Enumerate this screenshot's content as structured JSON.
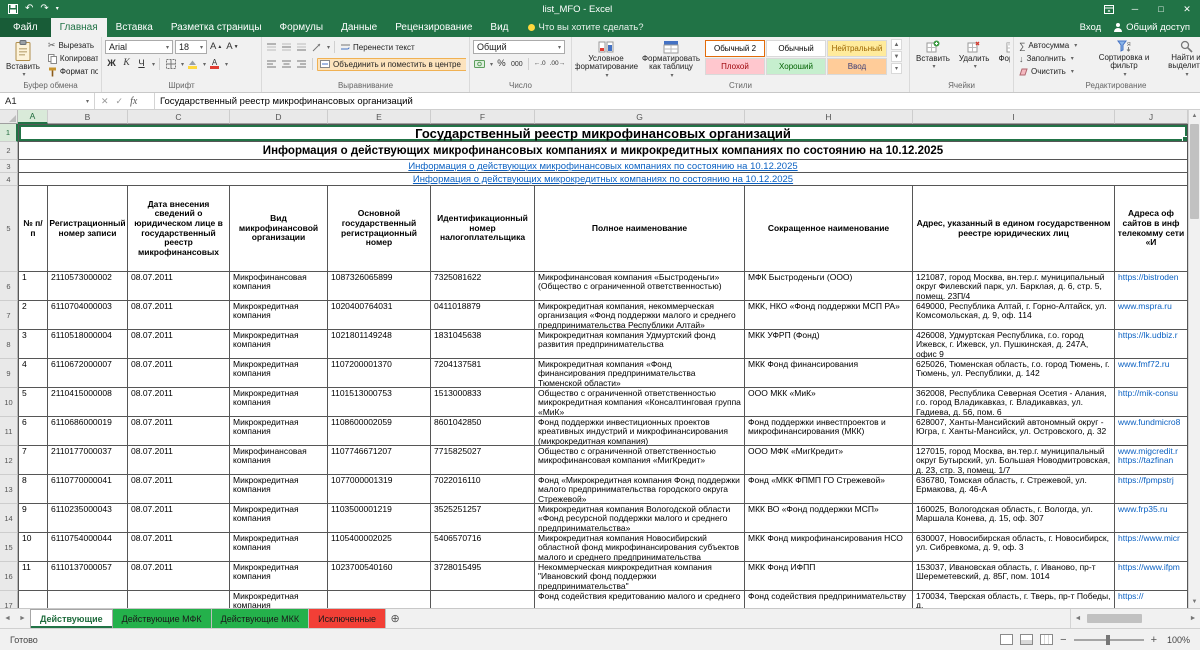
{
  "window": {
    "title": "list_MFO - Excel",
    "sign_in": "Вход",
    "share": "Общий доступ"
  },
  "ribbon": {
    "file_tab": "Файл",
    "tabs": [
      "Главная",
      "Вставка",
      "Разметка страницы",
      "Формулы",
      "Данные",
      "Рецензирование",
      "Вид"
    ],
    "active_tab": "Главная",
    "tell_me": "Что вы хотите сделать?",
    "groups": {
      "clipboard": {
        "label": "Буфер обмена",
        "paste": "Вставить",
        "cut": "Вырезать",
        "copy": "Копировать",
        "painter": "Формат по образцу"
      },
      "font": {
        "label": "Шрифт",
        "family": "Arial",
        "size": "18",
        "bold": "Ж",
        "italic": "К",
        "underline": "Ч"
      },
      "alignment": {
        "label": "Выравнивание",
        "wrap": "Перенести текст",
        "merge": "Объединить и поместить в центре"
      },
      "number": {
        "label": "Число",
        "format": "Общий",
        "percent": "%",
        "thousands": "000"
      },
      "styles": {
        "label": "Стили",
        "conditional": "Условное форматирование",
        "as_table": "Форматировать как таблицу",
        "gallery": [
          {
            "name": "Обычный 2",
            "bg": "#ffffff",
            "fg": "#000000"
          },
          {
            "name": "Обычный",
            "bg": "#ffffff",
            "fg": "#000000"
          },
          {
            "name": "Нейтральный",
            "bg": "#ffeb9c",
            "fg": "#9c6500"
          },
          {
            "name": "Плохой",
            "bg": "#ffc7ce",
            "fg": "#9c0006"
          },
          {
            "name": "Хороший",
            "bg": "#c6efce",
            "fg": "#006100"
          },
          {
            "name": "Ввод",
            "bg": "#ffcc99",
            "fg": "#3f3f76"
          }
        ]
      },
      "cells": {
        "label": "Ячейки",
        "insert": "Вставить",
        "delete": "Удалить",
        "format": "Формат"
      },
      "editing": {
        "label": "Редактирование",
        "autosum": "Автосумма",
        "fill": "Заполнить",
        "clear": "Очистить",
        "sort": "Сортировка и фильтр",
        "find": "Найти и выделить"
      }
    }
  },
  "formula_bar": {
    "name_box": "A1",
    "fx": "fx",
    "value": "Государственный реестр микрофинансовых организаций"
  },
  "sheet": {
    "col_letters": [
      "A",
      "B",
      "C",
      "D",
      "E",
      "F",
      "G",
      "H",
      "I",
      "J"
    ],
    "top_rows": [
      {
        "row": 1,
        "style": "m-title",
        "text": "Государственный реестр микрофинансовых организаций"
      },
      {
        "row": 2,
        "style": "m-subtitle",
        "text": "Информация о действующих микрофинансовых компаниях и микрокредитных компаниях по состоянию на 10.12.2025"
      },
      {
        "row": 3,
        "style": "m-link",
        "text": "Информация о действующих микрофинансовых компаниях по состоянию на 10.12.2025"
      },
      {
        "row": 4,
        "style": "m-link",
        "text": "Информация о действующих микрокредитных компаниях по состоянию на 10.12.2025"
      }
    ],
    "header_row_num": 5,
    "headers": [
      "№ п/п",
      "Регистрационный номер записи",
      "Дата внесения сведений о юридическом лице в государственный реестр микрофинансовых",
      "Вид микрофинансовой организации",
      "Основной государственный регистрационный номер",
      "Идентификационный номер налогоплательщика",
      "Полное наименование",
      "Сокращенное наименование",
      "Адрес, указанный в едином государственном реестре юридических лиц",
      "Адреса оф сайтов в инф телекомму сети «И"
    ],
    "rows": [
      [
        "1",
        "2110573000002",
        "08.07.2011",
        "Микрофинансовая компания",
        "1087326065899",
        "7325081622",
        "Микрофинансовая компания «Быстроденьги» (Общество с ограниченной ответственностью)",
        "МФК Быстроденьги (ООО)",
        "121087, город Москва, вн.тер.г. муниципальный округ Филевский парк, ул. Барклая, д. 6, стр. 5, помещ. 23П/4",
        "https://bistroden"
      ],
      [
        "2",
        "6110704000003",
        "08.07.2011",
        "Микрокредитная компания",
        "1020400764031",
        "0411018879",
        "Микрокредитная компания, некоммерческая организация «Фонд поддержки малого и среднего предпринимательства Республики Алтай»",
        "МКК, НКО «Фонд поддержки МСП РА»",
        "649000, Республика Алтай, г. Горно-Алтайск, ул. Комсомольская, д. 9, оф. 114",
        "www.mspra.ru"
      ],
      [
        "3",
        "6110518000004",
        "08.07.2011",
        "Микрокредитная компания",
        "1021801149248",
        "1831045638",
        "Микрокредитная компания Удмуртский фонд развития предпринимательства",
        "МКК УФРП (Фонд)",
        "426008, Удмуртская Республика, г.о. город Ижевск, г. Ижевск, ул. Пушкинская, д. 247А, офис 9",
        "https://lk.udbiz.r"
      ],
      [
        "4",
        "6110672000007",
        "08.07.2011",
        "Микрокредитная компания",
        "1107200001370",
        "7204137581",
        "Микрокредитная компания «Фонд финансирования предпринимательства Тюменской области»",
        "МКК Фонд финансирования",
        "625026, Тюменская область, г.о. город Тюмень, г. Тюмень, ул. Республики, д. 142",
        "www.fmf72.ru"
      ],
      [
        "5",
        "2110415000008",
        "08.07.2011",
        "Микрокредитная компания",
        "1101513000753",
        "1513000833",
        "Общество с ограниченной ответственностью микрокредитная компания «Консалтинговая группа «МиК»",
        "ООО МКК «МиК»",
        "362008, Республика Северная Осетия - Алания, г.о. город Владикавказ, г. Владикавказ, ул. Гадиева, д. 56, пом. 6",
        "http://mik-consu"
      ],
      [
        "6",
        "6110686000019",
        "08.07.2011",
        "Микрокредитная компания",
        "1108600002059",
        "8601042850",
        "Фонд поддержки инвестиционных проектов креативных индустрий и микрофинансирования (микрокредитная компания)",
        "Фонд поддержки инвестпроектов и микрофинансирования (МКК)",
        "628007, Ханты-Мансийский автономный округ - Югра, г. Ханты-Мансийск, ул. Островского, д. 32",
        "www.fundmicro8"
      ],
      [
        "7",
        "2110177000037",
        "08.07.2011",
        "Микрофинансовая компания",
        "1107746671207",
        "7715825027",
        "Общество с ограниченной ответственностью микрофинансовая компания «МигКредит»",
        "ООО МФК «МигКредит»",
        "127015, город Москва, вн.тер.г. муниципальный округ Бутырский, ул. Большая Новодмитровская, д. 23, стр. 3, помещ. 1/7",
        "www.migcredit.r https://tazfinan"
      ],
      [
        "8",
        "6110770000041",
        "08.07.2011",
        "Микрокредитная компания",
        "1077000001319",
        "7022016110",
        "Фонд «Микрокредитная компания Фонд поддержки малого предпринимательства городского округа Стрежевой»",
        "Фонд «МКК ФПМП ГО Стрежевой»",
        "636780, Томская область, г. Стрежевой, ул. Ермакова, д. 46-А",
        "https://fpmpstrj"
      ],
      [
        "9",
        "6110235000043",
        "08.07.2011",
        "Микрокредитная компания",
        "1103500001219",
        "3525251257",
        "Микрокредитная компания Вологодской области «Фонд ресурсной поддержки малого и среднего предпринимательства»",
        "МКК ВО «Фонд поддержки МСП»",
        "160025, Вологодская область, г. Вологда, ул. Маршала Конева, д. 15, оф. 307",
        "www.frp35.ru"
      ],
      [
        "10",
        "6110754000044",
        "08.07.2011",
        "Микрокредитная компания",
        "1105400002025",
        "5406570716",
        "Микрокредитная компания Новосибирский областной фонд микрофинансирования субъектов малого и среднего предпринимательства",
        "МКК Фонд микрофинансирования НСО",
        "630007, Новосибирская область, г. Новосибирск, ул. Сибревкома, д. 9, оф. 3",
        "https://www.micr"
      ],
      [
        "11",
        "6110137000057",
        "08.07.2011",
        "Микрокредитная компания",
        "1023700540160",
        "3728015495",
        "Некоммерческая микрокредитная компания \"Ивановский фонд поддержки предпринимательства\"",
        "МКК Фонд ИФПП",
        "153037, Ивановская область, г. Иваново, пр-т Шереметевский, д. 85Г, пом. 1014",
        "https://www.ifpm"
      ]
    ],
    "partial_row": [
      "",
      "",
      "",
      "Микрокредитная компания",
      "",
      "",
      "Фонд содействия кредитованию малого и среднего",
      "Фонд содействия предпринимательству",
      "170034, Тверская область, г. Тверь, пр-т Победы, д.",
      "https://"
    ]
  },
  "sheet_tabs": {
    "tabs": [
      {
        "label": "Действующие",
        "color": "#217346",
        "active": true
      },
      {
        "label": "Действующие МФК",
        "color": "#24b14b",
        "active": false
      },
      {
        "label": "Действующие МКК",
        "color": "#24b14b",
        "active": false
      },
      {
        "label": "Исключенные",
        "color": "#f23f36",
        "active": false
      }
    ],
    "add": "⊕"
  },
  "status_bar": {
    "ready": "Готово",
    "zoom": "100%"
  }
}
